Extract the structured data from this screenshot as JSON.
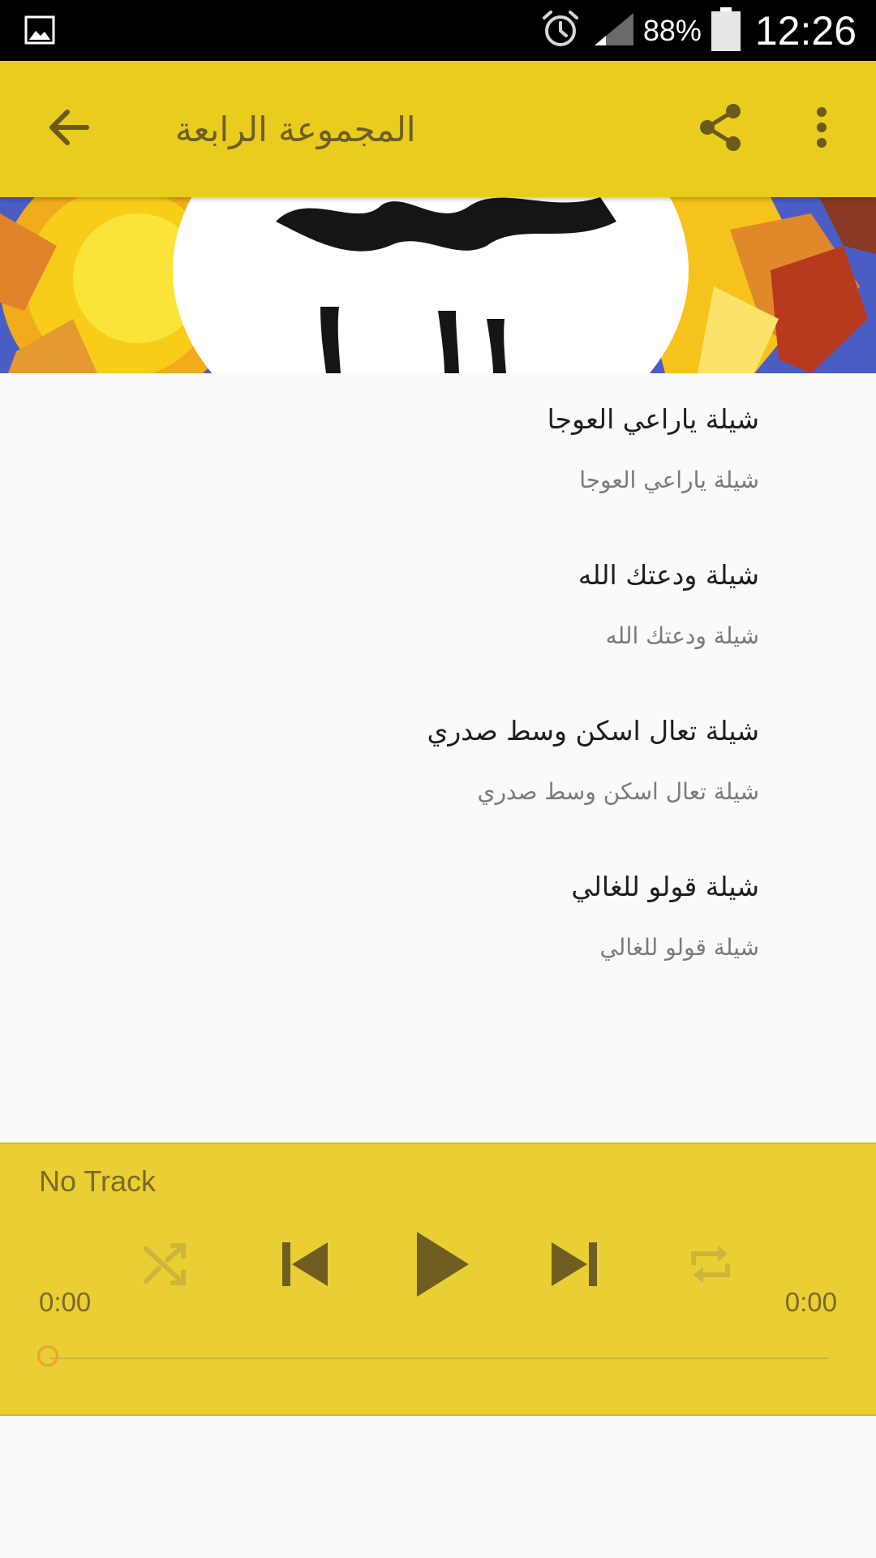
{
  "status_bar": {
    "battery_text": "88%",
    "time": "12:26",
    "icons": [
      "gallery-icon",
      "alarm-icon",
      "signal-icon",
      "battery-icon"
    ]
  },
  "toolbar": {
    "title": "المجموعة الرابعة",
    "back_icon": "arrow-back-icon",
    "share_icon": "share-icon",
    "overflow_icon": "more-vert-icon",
    "background": "#e9cc1e"
  },
  "banner": {
    "image": "album-cover-image"
  },
  "tracks": [
    {
      "title": "شيلة ياراعي العوجا",
      "subtitle": "شيلة ياراعي العوجا"
    },
    {
      "title": "شيلة ودعتك الله",
      "subtitle": "شيلة ودعتك الله"
    },
    {
      "title": "شيلة تعال اسكن وسط صدري",
      "subtitle": "شيلة تعال اسكن وسط صدري"
    },
    {
      "title": "شيلة قولو للغالي",
      "subtitle": "شيلة قولو للغالي"
    }
  ],
  "player": {
    "track_name": "No Track",
    "elapsed": "0:00",
    "total": "0:00",
    "progress": 0,
    "controls": [
      "shuffle-icon",
      "skip-previous-icon",
      "play-icon",
      "skip-next-icon",
      "repeat-icon"
    ],
    "background": "#e9cf33",
    "accent": "#f0a037"
  }
}
